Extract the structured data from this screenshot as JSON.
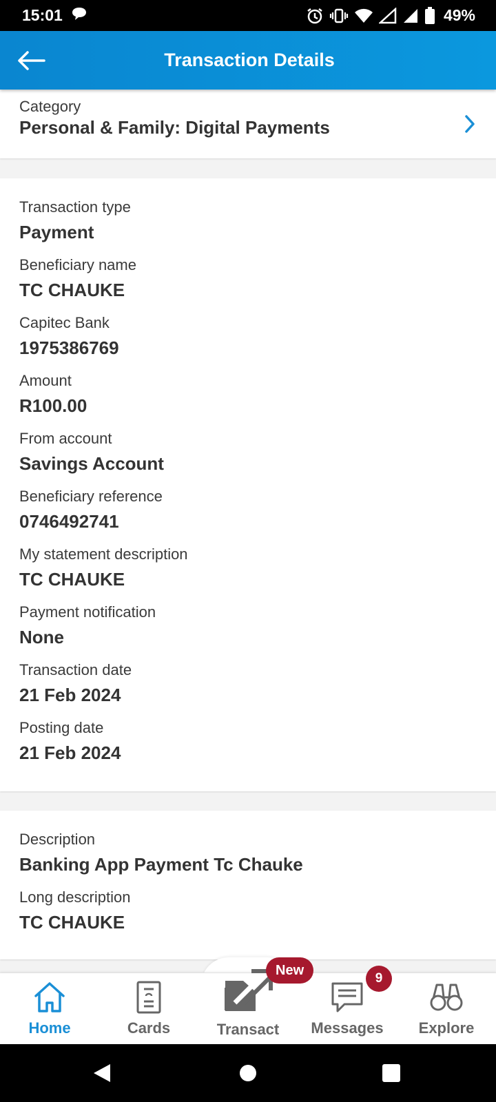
{
  "status_bar": {
    "time": "15:01",
    "battery": "49%",
    "icons": [
      "chat-bubble-icon",
      "alarm-icon",
      "vibrate-icon",
      "wifi-icon",
      "signal-icon",
      "signal-icon",
      "battery-icon"
    ]
  },
  "header": {
    "title": "Transaction Details",
    "back_icon": "arrow-left-icon"
  },
  "category": {
    "label": "Category",
    "value": "Personal & Family: Digital Payments"
  },
  "details": [
    {
      "label": "Transaction type",
      "value": "Payment"
    },
    {
      "label": "Beneficiary name",
      "value": "TC CHAUKE"
    },
    {
      "label": "Capitec Bank",
      "value": "1975386769"
    },
    {
      "label": "Amount",
      "value": "R100.00"
    },
    {
      "label": "From account",
      "value": "Savings Account"
    },
    {
      "label": "Beneficiary reference",
      "value": "0746492741"
    },
    {
      "label": "My statement description",
      "value": "TC CHAUKE"
    },
    {
      "label": "Payment notification",
      "value": "None"
    },
    {
      "label": "Transaction date",
      "value": "21 Feb 2024"
    },
    {
      "label": "Posting date",
      "value": "21 Feb 2024"
    }
  ],
  "descriptions": [
    {
      "label": "Description",
      "value": "Banking App Payment Tc Chauke"
    },
    {
      "label": "Long description",
      "value": "TC CHAUKE"
    }
  ],
  "bottom_nav": {
    "items": [
      {
        "label": "Home",
        "icon": "home-icon",
        "active": true
      },
      {
        "label": "Cards",
        "icon": "card-icon",
        "active": false
      },
      {
        "label": "Transact",
        "icon": "transfer-arrows-icon",
        "active": false
      },
      {
        "label": "Messages",
        "icon": "message-icon",
        "active": false
      },
      {
        "label": "Explore",
        "icon": "binoculars-icon",
        "active": false
      }
    ],
    "transact_badge": "New",
    "messages_badge": "9"
  },
  "colors": {
    "header_blue": "#0b8fd8",
    "accent_blue": "#1a8fd6",
    "badge_red": "#a6192e"
  }
}
